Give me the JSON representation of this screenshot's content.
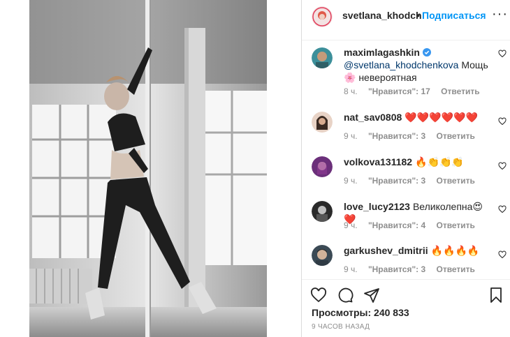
{
  "post": {
    "author": "svetlana_khodch",
    "separator": "•",
    "follow_label": "Подписаться",
    "more_label": "···"
  },
  "comments": [
    {
      "user": "maximlagashkin",
      "verified": true,
      "mention": "@svetlana_khodchenkova",
      "text": " Мощь🌸 невероятная",
      "time": "8 ч.",
      "likes": "\"Нравится\": 17",
      "reply": "Ответить"
    },
    {
      "user": "nat_sav0808",
      "text": "❤️❤️❤️❤️❤️❤️",
      "time": "9 ч.",
      "likes": "\"Нравится\": 3",
      "reply": "Ответить"
    },
    {
      "user": "volkova131182",
      "text": "🔥👏👏👏",
      "time": "9 ч.",
      "likes": "\"Нравится\": 3",
      "reply": "Ответить"
    },
    {
      "user": "love_lucy2123",
      "text": "Великолепна😍❤️",
      "time": "9 ч.",
      "likes": "\"Нравится\": 4",
      "reply": "Ответить"
    },
    {
      "user": "garkushev_dmitrii",
      "text": "🔥🔥🔥🔥",
      "time": "9 ч.",
      "likes": "\"Нравится\": 3",
      "reply": "Ответить"
    }
  ],
  "footer": {
    "views": "Просмотры: 240 833",
    "ago": "9 ЧАСОВ НАЗАД"
  },
  "icons": {
    "like": "heart-outline-icon",
    "comment": "comment-bubble-icon",
    "share": "paper-plane-icon",
    "save": "bookmark-icon"
  },
  "colors": {
    "link_blue": "#0095f6",
    "mention_blue": "#00376b",
    "muted": "#8e8e8e",
    "verified": "#3897f0"
  }
}
